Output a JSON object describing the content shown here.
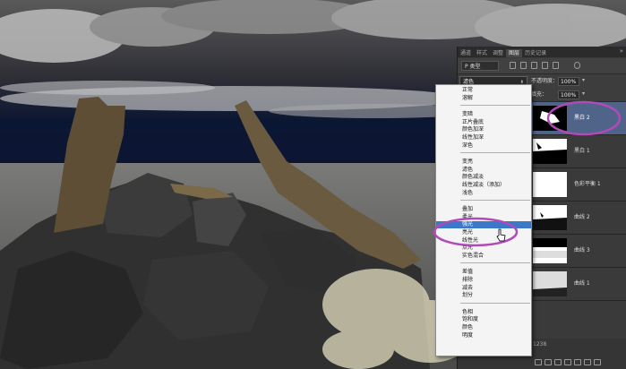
{
  "panel": {
    "tabs": [
      {
        "label": "通道",
        "active": false
      },
      {
        "label": "样式",
        "active": false
      },
      {
        "label": "调整",
        "active": false
      },
      {
        "label": "图层",
        "active": true
      },
      {
        "label": "历史记录",
        "active": false
      }
    ],
    "collapse_icon": "double-chevron-right-icon",
    "kind_filter": "P 类型",
    "blend_mode": "滤色",
    "opacity_label": "不透明度：",
    "opacity_value": "100%",
    "fill_label": "填充：",
    "fill_value": "100%",
    "size_text": "1238",
    "layers": [
      {
        "name": "黑白 2",
        "selected": true
      },
      {
        "name": "黑白 1",
        "selected": false
      },
      {
        "name": "色彩平衡 1",
        "selected": false
      },
      {
        "name": "曲线 2",
        "selected": false
      },
      {
        "name": "曲线 3",
        "selected": false
      },
      {
        "name": "曲线 1",
        "selected": false
      }
    ]
  },
  "blend_menu": {
    "items": [
      {
        "label": "正常",
        "group": 1
      },
      {
        "label": "溶解",
        "group": 1
      },
      {
        "label": "变暗",
        "group": 2
      },
      {
        "label": "正片叠底",
        "group": 2
      },
      {
        "label": "颜色加深",
        "group": 2
      },
      {
        "label": "线性加深",
        "group": 2
      },
      {
        "label": "深色",
        "group": 2
      },
      {
        "label": "变亮",
        "group": 3
      },
      {
        "label": "滤色",
        "group": 3
      },
      {
        "label": "颜色减淡",
        "group": 3
      },
      {
        "label": "线性减淡（添加）",
        "group": 3
      },
      {
        "label": "浅色",
        "group": 3
      },
      {
        "label": "叠加",
        "group": 4
      },
      {
        "label": "柔光",
        "group": 4
      },
      {
        "label": "强光",
        "group": 4,
        "highlighted": true
      },
      {
        "label": "亮光",
        "group": 4
      },
      {
        "label": "线性光",
        "group": 4
      },
      {
        "label": "点光",
        "group": 4
      },
      {
        "label": "实色混合",
        "group": 4
      },
      {
        "label": "差值",
        "group": 5
      },
      {
        "label": "排除",
        "group": 5
      },
      {
        "label": "减去",
        "group": 5
      },
      {
        "label": "划分",
        "group": 5
      },
      {
        "label": "色相",
        "group": 6
      },
      {
        "label": "饱和度",
        "group": 6
      },
      {
        "label": "颜色",
        "group": 6
      },
      {
        "label": "明度",
        "group": 6
      }
    ]
  },
  "colors": {
    "highlight": "#3b78c8",
    "selected_layer": "#50648a",
    "annotation": "#b04ab8"
  }
}
